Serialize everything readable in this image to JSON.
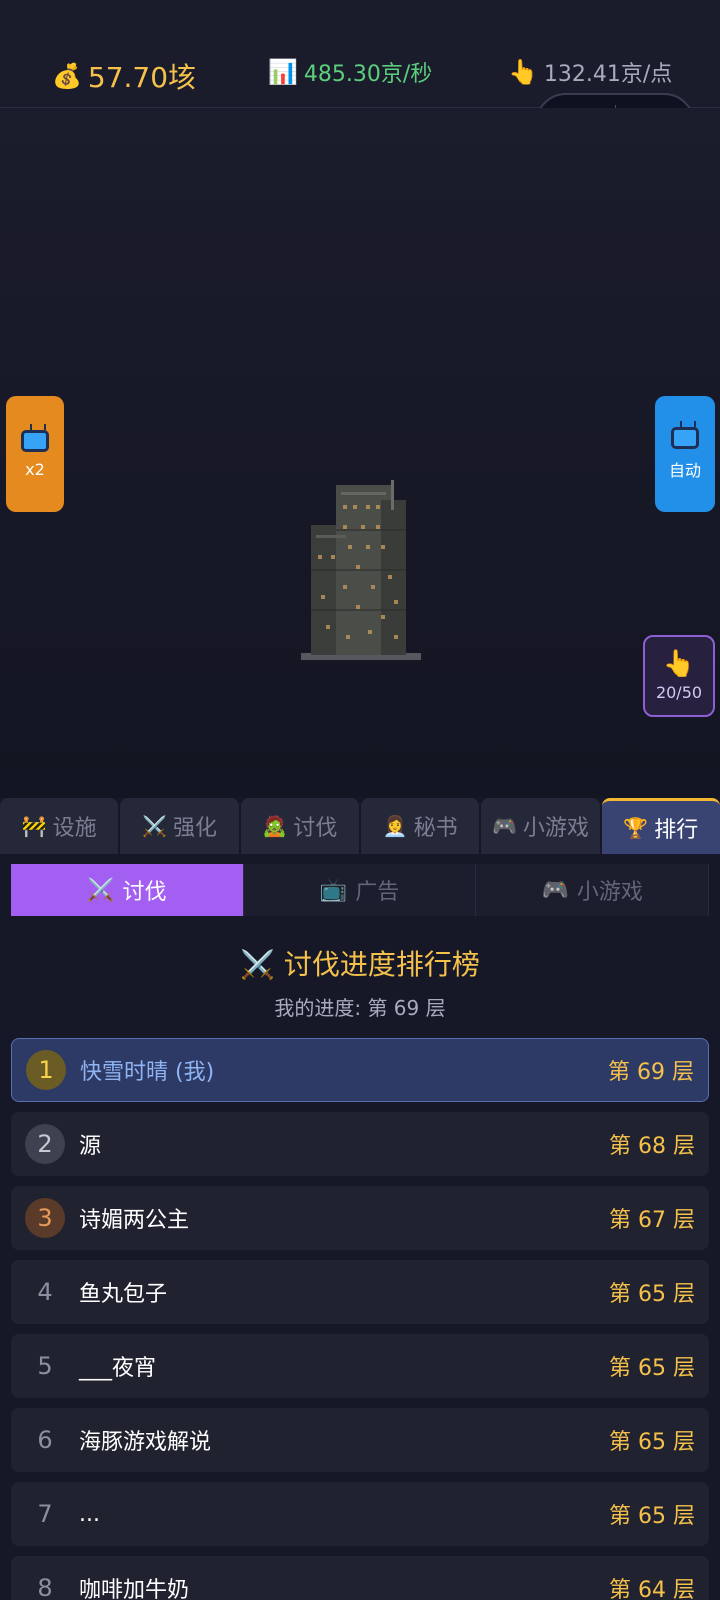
{
  "stats": {
    "gold": "57.70垓",
    "rate": "485.30京/秒",
    "per_tap": "132.41京/点"
  },
  "side_buttons": {
    "x2_label": "x2",
    "auto_label": "自动",
    "tap_counter": "20/50"
  },
  "main_tabs": [
    {
      "label": "设施",
      "icon": "🚧"
    },
    {
      "label": "强化",
      "icon": "⚔️"
    },
    {
      "label": "讨伐",
      "icon": "🧟"
    },
    {
      "label": "秘书",
      "icon": "👩‍💼"
    },
    {
      "label": "小游戏",
      "icon": "🎮"
    },
    {
      "label": "排行",
      "icon": "🏆"
    }
  ],
  "sub_tabs": [
    {
      "label": "讨伐",
      "icon": "⚔️"
    },
    {
      "label": "广告",
      "icon": "📺"
    },
    {
      "label": "小游戏",
      "icon": "🎮"
    }
  ],
  "ranking": {
    "title": "⚔️ 讨伐进度排行榜",
    "my_progress": "我的进度: 第 69 层",
    "rows": [
      {
        "rank": "1",
        "name": "快雪时晴 (我)",
        "level": "第 69 层"
      },
      {
        "rank": "2",
        "name": "源",
        "level": "第 68 层"
      },
      {
        "rank": "3",
        "name": "诗媚两公主",
        "level": "第 67 层"
      },
      {
        "rank": "4",
        "name": "鱼丸包子",
        "level": "第 65 层"
      },
      {
        "rank": "5",
        "name": "___夜宵",
        "level": "第 65 层"
      },
      {
        "rank": "6",
        "name": "海豚游戏解说",
        "level": "第 65 层"
      },
      {
        "rank": "7",
        "name": "...",
        "level": "第 65 层"
      },
      {
        "rank": "8",
        "name": "咖啡加牛奶",
        "level": "第 64 层"
      }
    ]
  }
}
